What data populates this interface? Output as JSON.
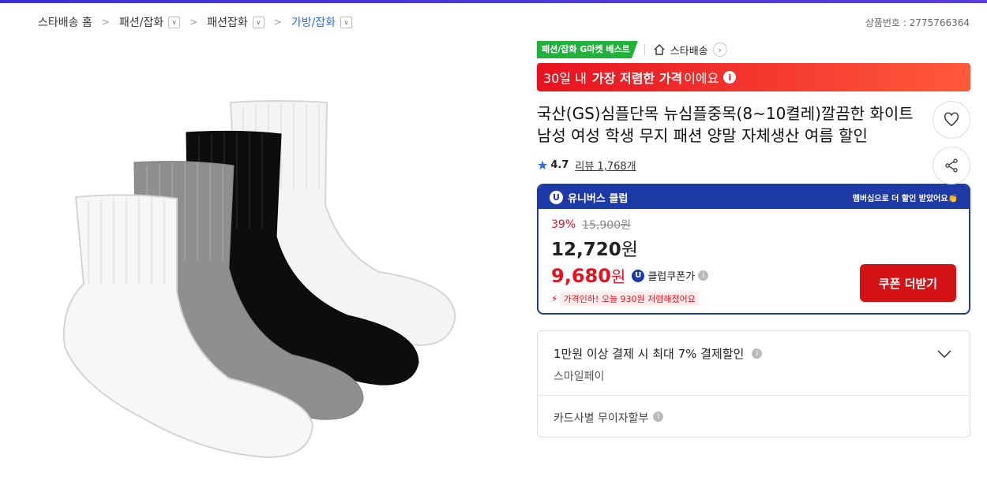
{
  "breadcrumb": {
    "items": [
      {
        "label": "스타배송 홈",
        "dropdown": false,
        "active": false
      },
      {
        "label": "패션/잡화",
        "dropdown": true,
        "active": false
      },
      {
        "label": "패션잡화",
        "dropdown": true,
        "active": false
      },
      {
        "label": "가방/잡화",
        "dropdown": true,
        "active": true
      }
    ],
    "product_number": "상품번호 : 2775766364"
  },
  "badges": {
    "best": "패션/잡화 G마켓 베스트",
    "store": "스타배송"
  },
  "lowest_banner": {
    "prefix": "30일 내",
    "bold": "가장 저렴한 가격",
    "suffix": "이에요"
  },
  "product": {
    "title": "국산(GS)심플단목 뉴심플중목(8~10켤레)깔끔한 화이트 남성 여성 학생 무지 패션 양말 자체생산 여름 할인",
    "rating": "4.7",
    "review": "리뷰 1,768개"
  },
  "club": {
    "title": "유니버스 클럽",
    "message": "멤버십으로 더 할인 받았어요👏",
    "discount_rate": "39%",
    "original_price": "15,900원",
    "sale_price": "12,720",
    "sale_unit": "원",
    "coupon_price": "9,680",
    "coupon_unit": "원",
    "coupon_label": "클럽쿠폰가",
    "drop_notice": "가격인하! 오늘 930원 저렴해졌어요",
    "coupon_button": "쿠폰 더받기"
  },
  "payment": {
    "title": "1만원 이상 결제 시 최대 7% 결제할인",
    "subtitle": "스마일페이",
    "installment": "카드사별 무이자할부"
  },
  "colors": {
    "accent_red": "#e8121f",
    "club_blue": "#1e3aa6",
    "best_green": "#21b23c",
    "star_blue": "#2c6de0"
  }
}
